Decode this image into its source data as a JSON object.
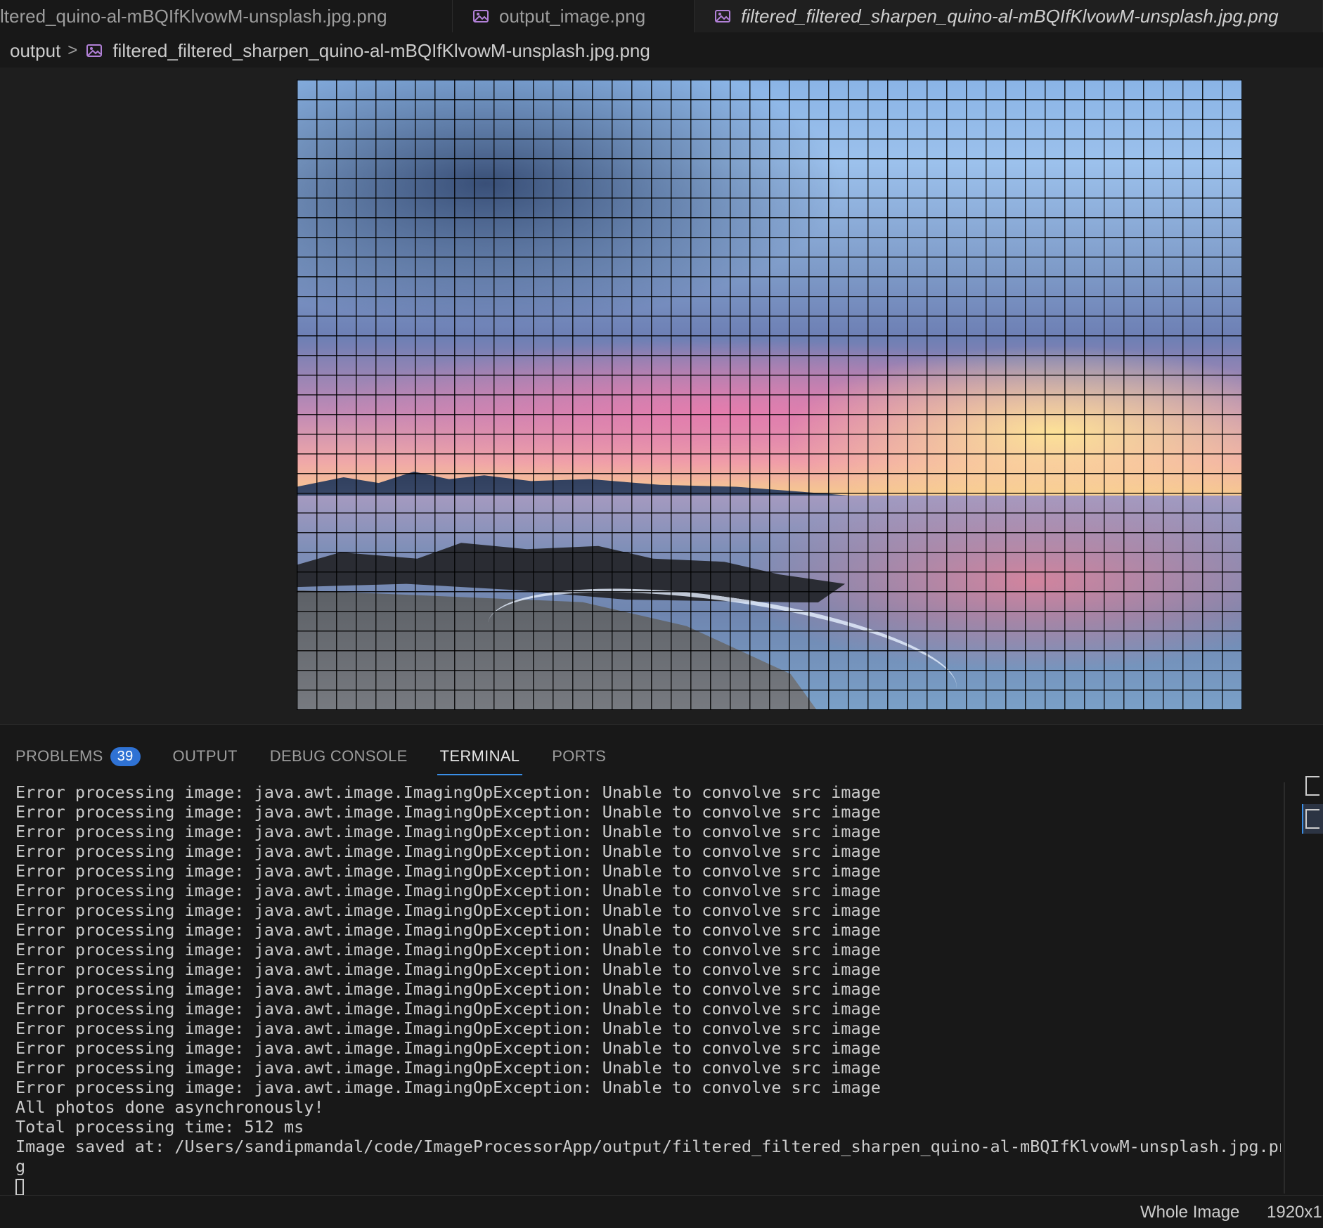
{
  "tabs": [
    {
      "label": "ltered_quino-al-mBQIfKlvowM-unsplash.jpg.png",
      "icon": "image-icon",
      "active": false
    },
    {
      "label": "output_image.png",
      "icon": "image-icon",
      "active": false
    },
    {
      "label": "filtered_filtered_sharpen_quino-al-mBQIfKlvowM-unsplash.jpg.png",
      "icon": "image-icon",
      "active": true
    }
  ],
  "breadcrumb": {
    "folder": "output",
    "separator": ">",
    "file": "filtered_filtered_sharpen_quino-al-mBQIfKlvowM-unsplash.jpg.png"
  },
  "panel": {
    "tabs": [
      {
        "label": "PROBLEMS",
        "badge": "39"
      },
      {
        "label": "OUTPUT"
      },
      {
        "label": "DEBUG CONSOLE"
      },
      {
        "label": "TERMINAL",
        "active": true
      },
      {
        "label": "PORTS"
      }
    ],
    "terminal_lines": [
      "Error processing image: java.awt.image.ImagingOpException: Unable to convolve src image",
      "Error processing image: java.awt.image.ImagingOpException: Unable to convolve src image",
      "Error processing image: java.awt.image.ImagingOpException: Unable to convolve src image",
      "Error processing image: java.awt.image.ImagingOpException: Unable to convolve src image",
      "Error processing image: java.awt.image.ImagingOpException: Unable to convolve src image",
      "Error processing image: java.awt.image.ImagingOpException: Unable to convolve src image",
      "Error processing image: java.awt.image.ImagingOpException: Unable to convolve src image",
      "Error processing image: java.awt.image.ImagingOpException: Unable to convolve src image",
      "Error processing image: java.awt.image.ImagingOpException: Unable to convolve src image",
      "Error processing image: java.awt.image.ImagingOpException: Unable to convolve src image",
      "Error processing image: java.awt.image.ImagingOpException: Unable to convolve src image",
      "Error processing image: java.awt.image.ImagingOpException: Unable to convolve src image",
      "Error processing image: java.awt.image.ImagingOpException: Unable to convolve src image",
      "Error processing image: java.awt.image.ImagingOpException: Unable to convolve src image",
      "Error processing image: java.awt.image.ImagingOpException: Unable to convolve src image",
      "Error processing image: java.awt.image.ImagingOpException: Unable to convolve src image",
      "All photos done asynchronously!",
      "Total processing time: 512 ms",
      "Image saved at: /Users/sandipmandal/code/ImageProcessorApp/output/filtered_filtered_sharpen_quino-al-mBQIfKlvowM-unsplash.jpg.pn",
      "g"
    ]
  },
  "status": {
    "selection": "Whole Image",
    "dimensions": "1920x1"
  },
  "colors": {
    "accent": "#3a8ee6",
    "badge": "#2f72d4",
    "background": "#181818"
  }
}
